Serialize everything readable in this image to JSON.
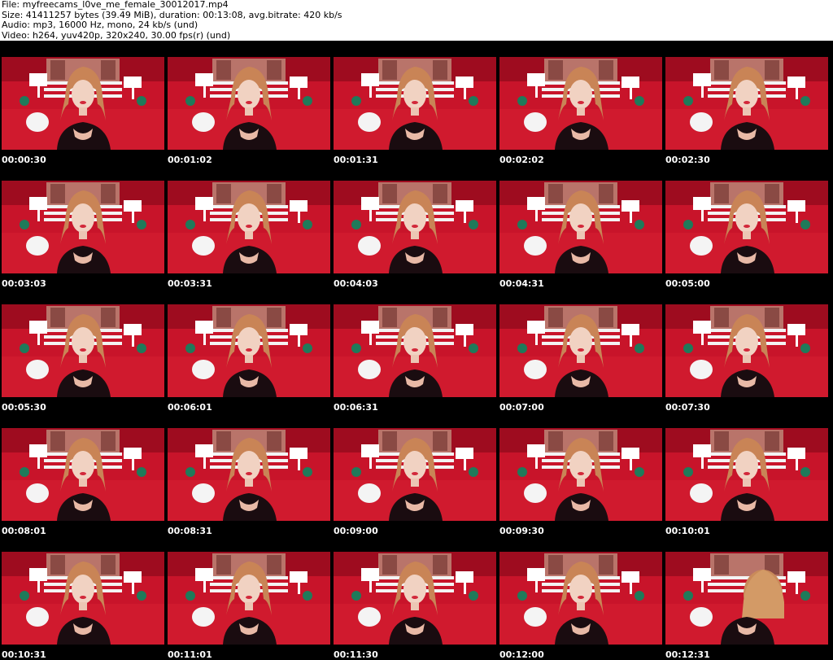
{
  "header": {
    "file_line": "File: myfreecams_l0ve_me_female_30012017.mp4",
    "size_line": "Size: 41411257 bytes (39.49 MiB), duration: 00:13:08, avg.bitrate: 420 kb/s",
    "audio_line": "Audio: mp3, 16000 Hz, mono, 24 kb/s (und)",
    "video_line": "Video: h264, yuv420p, 320x240, 30.00 fps(r) (und)"
  },
  "grid": {
    "columns": 5,
    "rows": 5
  },
  "colors": {
    "sheet_background": "#000000",
    "timestamp_text": "#ffffff",
    "header_text": "#000000",
    "frame_red": "#c8142a"
  },
  "thumbnails": [
    {
      "timestamp": "00:00:30"
    },
    {
      "timestamp": "00:01:02"
    },
    {
      "timestamp": "00:01:31"
    },
    {
      "timestamp": "00:02:02"
    },
    {
      "timestamp": "00:02:30"
    },
    {
      "timestamp": "00:03:03"
    },
    {
      "timestamp": "00:03:31"
    },
    {
      "timestamp": "00:04:03"
    },
    {
      "timestamp": "00:04:31"
    },
    {
      "timestamp": "00:05:00"
    },
    {
      "timestamp": "00:05:30"
    },
    {
      "timestamp": "00:06:01"
    },
    {
      "timestamp": "00:06:31"
    },
    {
      "timestamp": "00:07:00"
    },
    {
      "timestamp": "00:07:30"
    },
    {
      "timestamp": "00:08:01"
    },
    {
      "timestamp": "00:08:31"
    },
    {
      "timestamp": "00:09:00"
    },
    {
      "timestamp": "00:09:30"
    },
    {
      "timestamp": "00:10:01"
    },
    {
      "timestamp": "00:10:31"
    },
    {
      "timestamp": "00:11:01"
    },
    {
      "timestamp": "00:11:30"
    },
    {
      "timestamp": "00:12:00"
    },
    {
      "timestamp": "00:12:31"
    }
  ]
}
